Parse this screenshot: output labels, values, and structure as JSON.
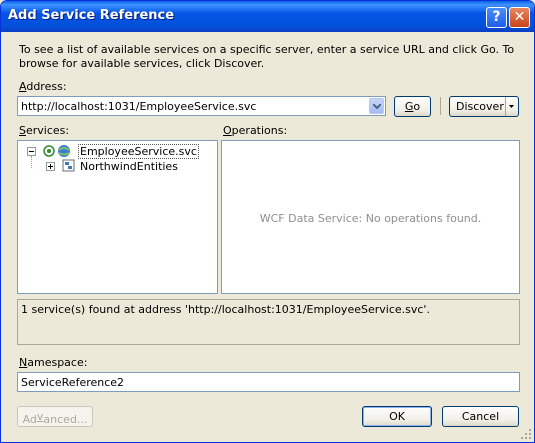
{
  "window": {
    "title": "Add Service Reference",
    "help_glyph": "?",
    "close_glyph": "✕"
  },
  "description": "To see a list of available services on a specific server, enter a service URL and click Go. To browse for available services, click Discover.",
  "address": {
    "label_accel": "A",
    "label_rest": "ddress:",
    "value": "http://localhost:1031/EmployeeService.svc",
    "go_accel": "G",
    "go_rest": "o",
    "discover_label": "Discover"
  },
  "services": {
    "label_accel": "S",
    "label_rest": "ervices:",
    "tree": [
      {
        "label": "EmployeeService.svc",
        "expanded": true
      },
      {
        "label": "NorthwindEntities",
        "expanded": false
      }
    ]
  },
  "operations": {
    "label_accel": "O",
    "label_rest": "perations:",
    "empty_message": "WCF Data Service: No operations found."
  },
  "status_text": "1 service(s) found at address 'http://localhost:1031/EmployeeService.svc'.",
  "namespace": {
    "label_accel": "N",
    "label_rest": "amespace:",
    "value": "ServiceReference2"
  },
  "buttons": {
    "advanced_pre": "Ad",
    "advanced_accel": "v",
    "advanced_post": "anced...",
    "ok": "OK",
    "cancel": "Cancel"
  }
}
